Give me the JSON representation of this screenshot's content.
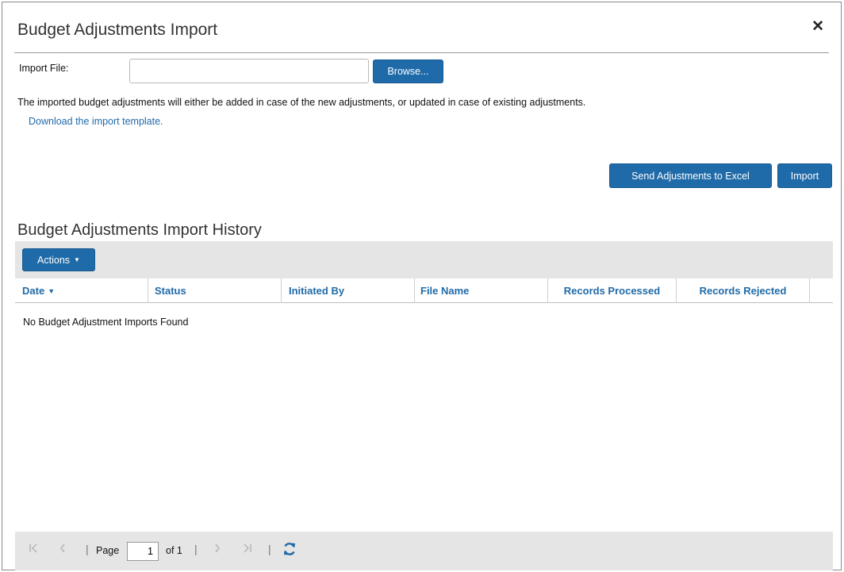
{
  "dialog": {
    "title": "Budget Adjustments Import",
    "close_icon": "close-icon"
  },
  "form": {
    "import_file_label": "Import File:",
    "import_file_value": "",
    "browse_label": "Browse...",
    "info_text": "The imported budget adjustments will either be added in case of the new adjustments, or updated in case of existing adjustments.",
    "template_link": "Download the import template.",
    "send_to_excel_label": "Send Adjustments to Excel",
    "import_label": "Import"
  },
  "history": {
    "title": "Budget Adjustments Import History",
    "actions_label": "Actions",
    "actions_icon": "caret-down-icon",
    "columns": [
      "Date",
      "Status",
      "Initiated By",
      "File Name",
      "Records Processed",
      "Records Rejected"
    ],
    "sort_indicator": "▼",
    "empty_message": "No Budget Adjustment Imports Found"
  },
  "pager": {
    "page_label": "Page",
    "page_value": "1",
    "of_label": "of 1",
    "icons": [
      "first-page-icon",
      "prev-page-icon",
      "next-page-icon",
      "last-page-icon",
      "refresh-icon"
    ]
  },
  "colors": {
    "primary": "#1f6aa8",
    "toolbar_bg": "#e5e5e5"
  }
}
